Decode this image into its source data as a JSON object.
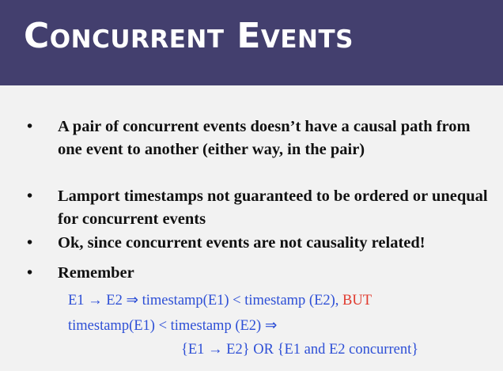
{
  "slide": {
    "title": "Concurrent Events",
    "bullet_symbol": "•",
    "bullets": [
      "A pair of concurrent events doesn’t have a causal path from one event to another (either way, in the pair)",
      "Lamport timestamps not guaranteed to be ordered or unequal for concurrent events",
      "Ok, since concurrent events are not causality related!",
      "Remember"
    ],
    "formula": {
      "line1": "E1 → E2 ⇒  timestamp(E1) < timestamp (E2),",
      "line1_but": "BUT",
      "line2": "timestamp(E1) < timestamp (E2)  ⇒",
      "line3": "{E1 → E2} OR {E1 and E2 concurrent}"
    },
    "colors": {
      "header": "#433f6e",
      "background": "#f2f2f2",
      "formula_text": "#2d4fd6",
      "but_text": "#e03a2e"
    }
  }
}
